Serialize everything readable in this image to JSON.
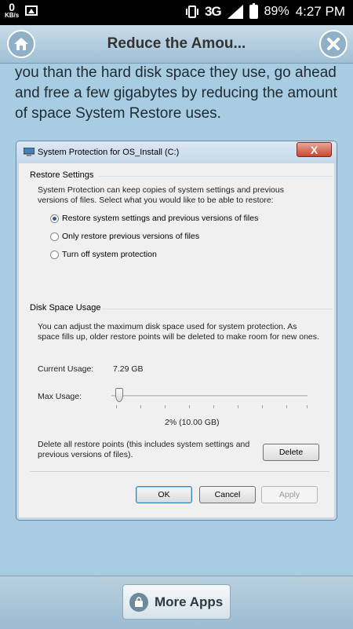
{
  "status_bar": {
    "kbs_value": "0",
    "kbs_unit": "KB/s",
    "network": "3G",
    "battery": "89%",
    "time": "4:27 PM"
  },
  "header": {
    "title": "Reduce the Amou...",
    "home_icon": "home-icon",
    "close_icon": "close-icon"
  },
  "article": {
    "text": "you than the hard disk space they use, go ahead and free a few gigabytes by reducing the amount of space System Restore uses."
  },
  "dialog": {
    "title": "System Protection for OS_Install (C:)",
    "close_label": "X",
    "restore_settings": {
      "label": "Restore Settings",
      "description": "System Protection can keep copies of system settings and previous versions of files. Select what you would like to be able to restore:",
      "options": [
        {
          "label": "Restore system settings and previous versions of files",
          "selected": true
        },
        {
          "label": "Only restore previous versions of files",
          "selected": false
        },
        {
          "label": "Turn off system protection",
          "selected": false
        }
      ]
    },
    "disk_space": {
      "label": "Disk Space Usage",
      "description": "You can adjust the maximum disk space used for system protection. As space fills up, older restore points will be deleted to make room for new ones.",
      "current_usage_label": "Current Usage:",
      "current_usage_value": "7.29 GB",
      "max_usage_label": "Max Usage:",
      "max_usage_value": "2% (10.00 GB)",
      "slider_fraction": 0.02,
      "delete_text": "Delete all restore points (this includes system settings and previous versions of files).",
      "delete_button": "Delete"
    },
    "buttons": {
      "ok": "OK",
      "cancel": "Cancel",
      "apply": "Apply"
    }
  },
  "footer": {
    "more_apps": "More Apps"
  }
}
